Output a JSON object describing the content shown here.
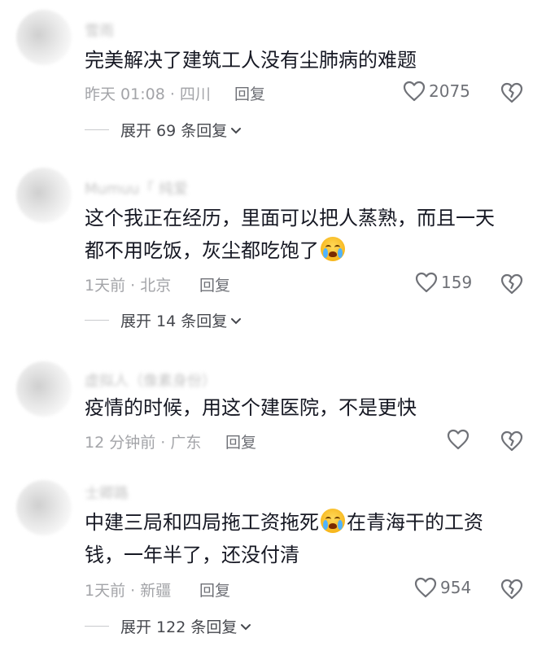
{
  "comments": [
    {
      "username": "雪雨",
      "text": "完美解决了建筑工人没有尘肺病的难题",
      "time_location": "昨天 01:08 · 四川",
      "reply_label": "回复",
      "likes": "2075",
      "expand_label": "展开 69 条回复"
    },
    {
      "username": "Mumuu「 纯爱",
      "text": "这个我正在经历，里面可以把人蒸熟，而且一天都不用吃饭，灰尘都吃饱了",
      "emoji": "crying-face-emoji",
      "time_location": "1天前 · 北京",
      "reply_label": "回复",
      "likes": "159",
      "expand_label": "展开 14 条回复"
    },
    {
      "username": "虚拟人（像素身份）",
      "text": "疫情的时候，用这个建医院，不是更快",
      "time_location": "12 分钟前 · 广东",
      "reply_label": "回复",
      "likes": ""
    },
    {
      "username": "士卿路",
      "text_before": "中建三局和四局拖工资拖死",
      "emoji": "loudly-crying-face-emoji",
      "text_after": "在青海干的工资钱，一年半了，还没付清",
      "time_location": "1天前 · 新疆",
      "reply_label": "回复",
      "likes": "954",
      "expand_label": "展开 122 条回复"
    }
  ],
  "colors": {
    "text": "#161823",
    "meta": "#a3a4a8",
    "icon": "#6f7177"
  }
}
